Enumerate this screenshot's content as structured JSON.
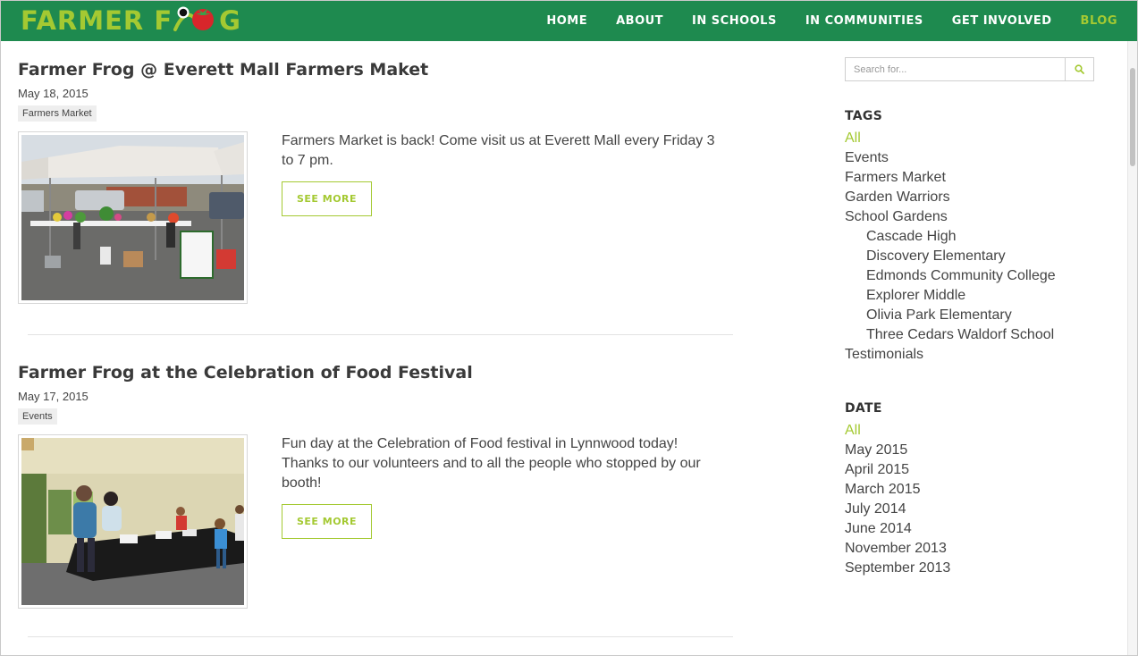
{
  "header": {
    "logo_text_left": "FARMER F",
    "logo_text_right": "G",
    "nav": [
      {
        "label": "HOME",
        "active": false
      },
      {
        "label": "ABOUT",
        "active": false
      },
      {
        "label": "IN SCHOOLS",
        "active": false
      },
      {
        "label": "IN COMMUNITIES",
        "active": false
      },
      {
        "label": "GET INVOLVED",
        "active": false
      },
      {
        "label": "BLOG",
        "active": true
      }
    ]
  },
  "posts": [
    {
      "title": "Farmer Frog @ Everett Mall Farmers Maket",
      "date": "May 18, 2015",
      "tag": "Farmers Market",
      "excerpt": "Farmers Market is back! Come visit us at Everett Mall every Friday 3 to 7 pm.",
      "button": "SEE MORE"
    },
    {
      "title": "Farmer Frog at the Celebration of Food Festival",
      "date": "May 17, 2015",
      "tag": "Events",
      "excerpt": "Fun day at the Celebration of Food festival in Lynnwood today! Thanks to our volunteers and to all the people who stopped by our booth!",
      "button": "SEE MORE"
    }
  ],
  "sidebar": {
    "search_placeholder": "Search for...",
    "tags_heading": "TAGS",
    "tags": [
      {
        "label": "All",
        "active": true,
        "sub": false
      },
      {
        "label": "Events",
        "active": false,
        "sub": false
      },
      {
        "label": "Farmers Market",
        "active": false,
        "sub": false
      },
      {
        "label": "Garden Warriors",
        "active": false,
        "sub": false
      },
      {
        "label": "School Gardens",
        "active": false,
        "sub": false
      },
      {
        "label": "Cascade High",
        "active": false,
        "sub": true
      },
      {
        "label": "Discovery Elementary",
        "active": false,
        "sub": true
      },
      {
        "label": "Edmonds Community College",
        "active": false,
        "sub": true
      },
      {
        "label": "Explorer Middle",
        "active": false,
        "sub": true
      },
      {
        "label": "Olivia Park Elementary",
        "active": false,
        "sub": true
      },
      {
        "label": "Three Cedars Waldorf School",
        "active": false,
        "sub": true
      },
      {
        "label": "Testimonials",
        "active": false,
        "sub": false
      }
    ],
    "date_heading": "DATE",
    "dates": [
      {
        "label": "All",
        "active": true
      },
      {
        "label": "May 2015",
        "active": false
      },
      {
        "label": "April 2015",
        "active": false
      },
      {
        "label": "March 2015",
        "active": false
      },
      {
        "label": "July 2014",
        "active": false
      },
      {
        "label": "June 2014",
        "active": false
      },
      {
        "label": "November 2013",
        "active": false
      },
      {
        "label": "September 2013",
        "active": false
      }
    ]
  },
  "colors": {
    "header_bg": "#1e8a4f",
    "accent_green": "#a4c932",
    "logo_red": "#d8262b"
  },
  "icons": {
    "search": "search-icon",
    "logo_mark": "frog-tomato-icon"
  }
}
